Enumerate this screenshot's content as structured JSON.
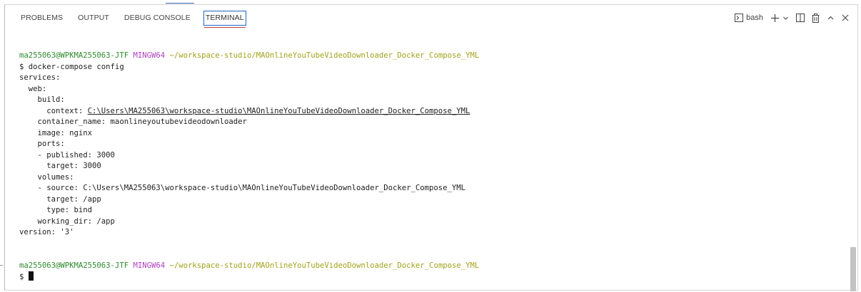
{
  "panel": {
    "tabs": [
      {
        "label": "PROBLEMS"
      },
      {
        "label": "OUTPUT"
      },
      {
        "label": "DEBUG CONSOLE"
      },
      {
        "label": "TERMINAL",
        "active": true
      }
    ],
    "actions": {
      "profile_icon": "terminal-icon",
      "profile_label": "bash",
      "new_terminal_icon": "plus-icon",
      "dropdown_icon": "chevron-down-icon",
      "split_icon": "split-pane-icon",
      "trash_icon": "trash-icon",
      "maximize_icon": "chevron-up-icon",
      "close_icon": "close-icon"
    }
  },
  "terminal": {
    "prompt1": {
      "user": "ma255063@WPKMA255063-JTF",
      "system": "MINGW64",
      "path": "~/workspace-studio/MAOnlineYouTubeVideoDownloader_Docker_Compose_YML"
    },
    "command": "$ docker-compose config",
    "output": {
      "l1": "services:",
      "l2": "  web:",
      "l3": "    build:",
      "l4_prefix": "      context: ",
      "l4_link": "C:\\Users\\MA255063\\workspace-studio\\MAOnlineYouTubeVideoDownloader_Docker_Compose_YML",
      "l5": "    container_name: maonlineyoutubevideodownloader",
      "l6": "    image: nginx",
      "l7": "    ports:",
      "l8": "    - published: 3000",
      "l9": "      target: 3000",
      "l10": "    volumes:",
      "l11": "    - source: C:\\Users\\MA255063\\workspace-studio\\MAOnlineYouTubeVideoDownloader_Docker_Compose_YML",
      "l12": "      target: /app",
      "l13": "      type: bind",
      "l14": "    working_dir: /app",
      "l15": "version: '3'"
    },
    "prompt2": {
      "user": "ma255063@WPKMA255063-JTF",
      "system": "MINGW64",
      "path": "~/workspace-studio/MAOnlineYouTubeVideoDownloader_Docker_Compose_YML"
    },
    "current_input": "$ "
  }
}
